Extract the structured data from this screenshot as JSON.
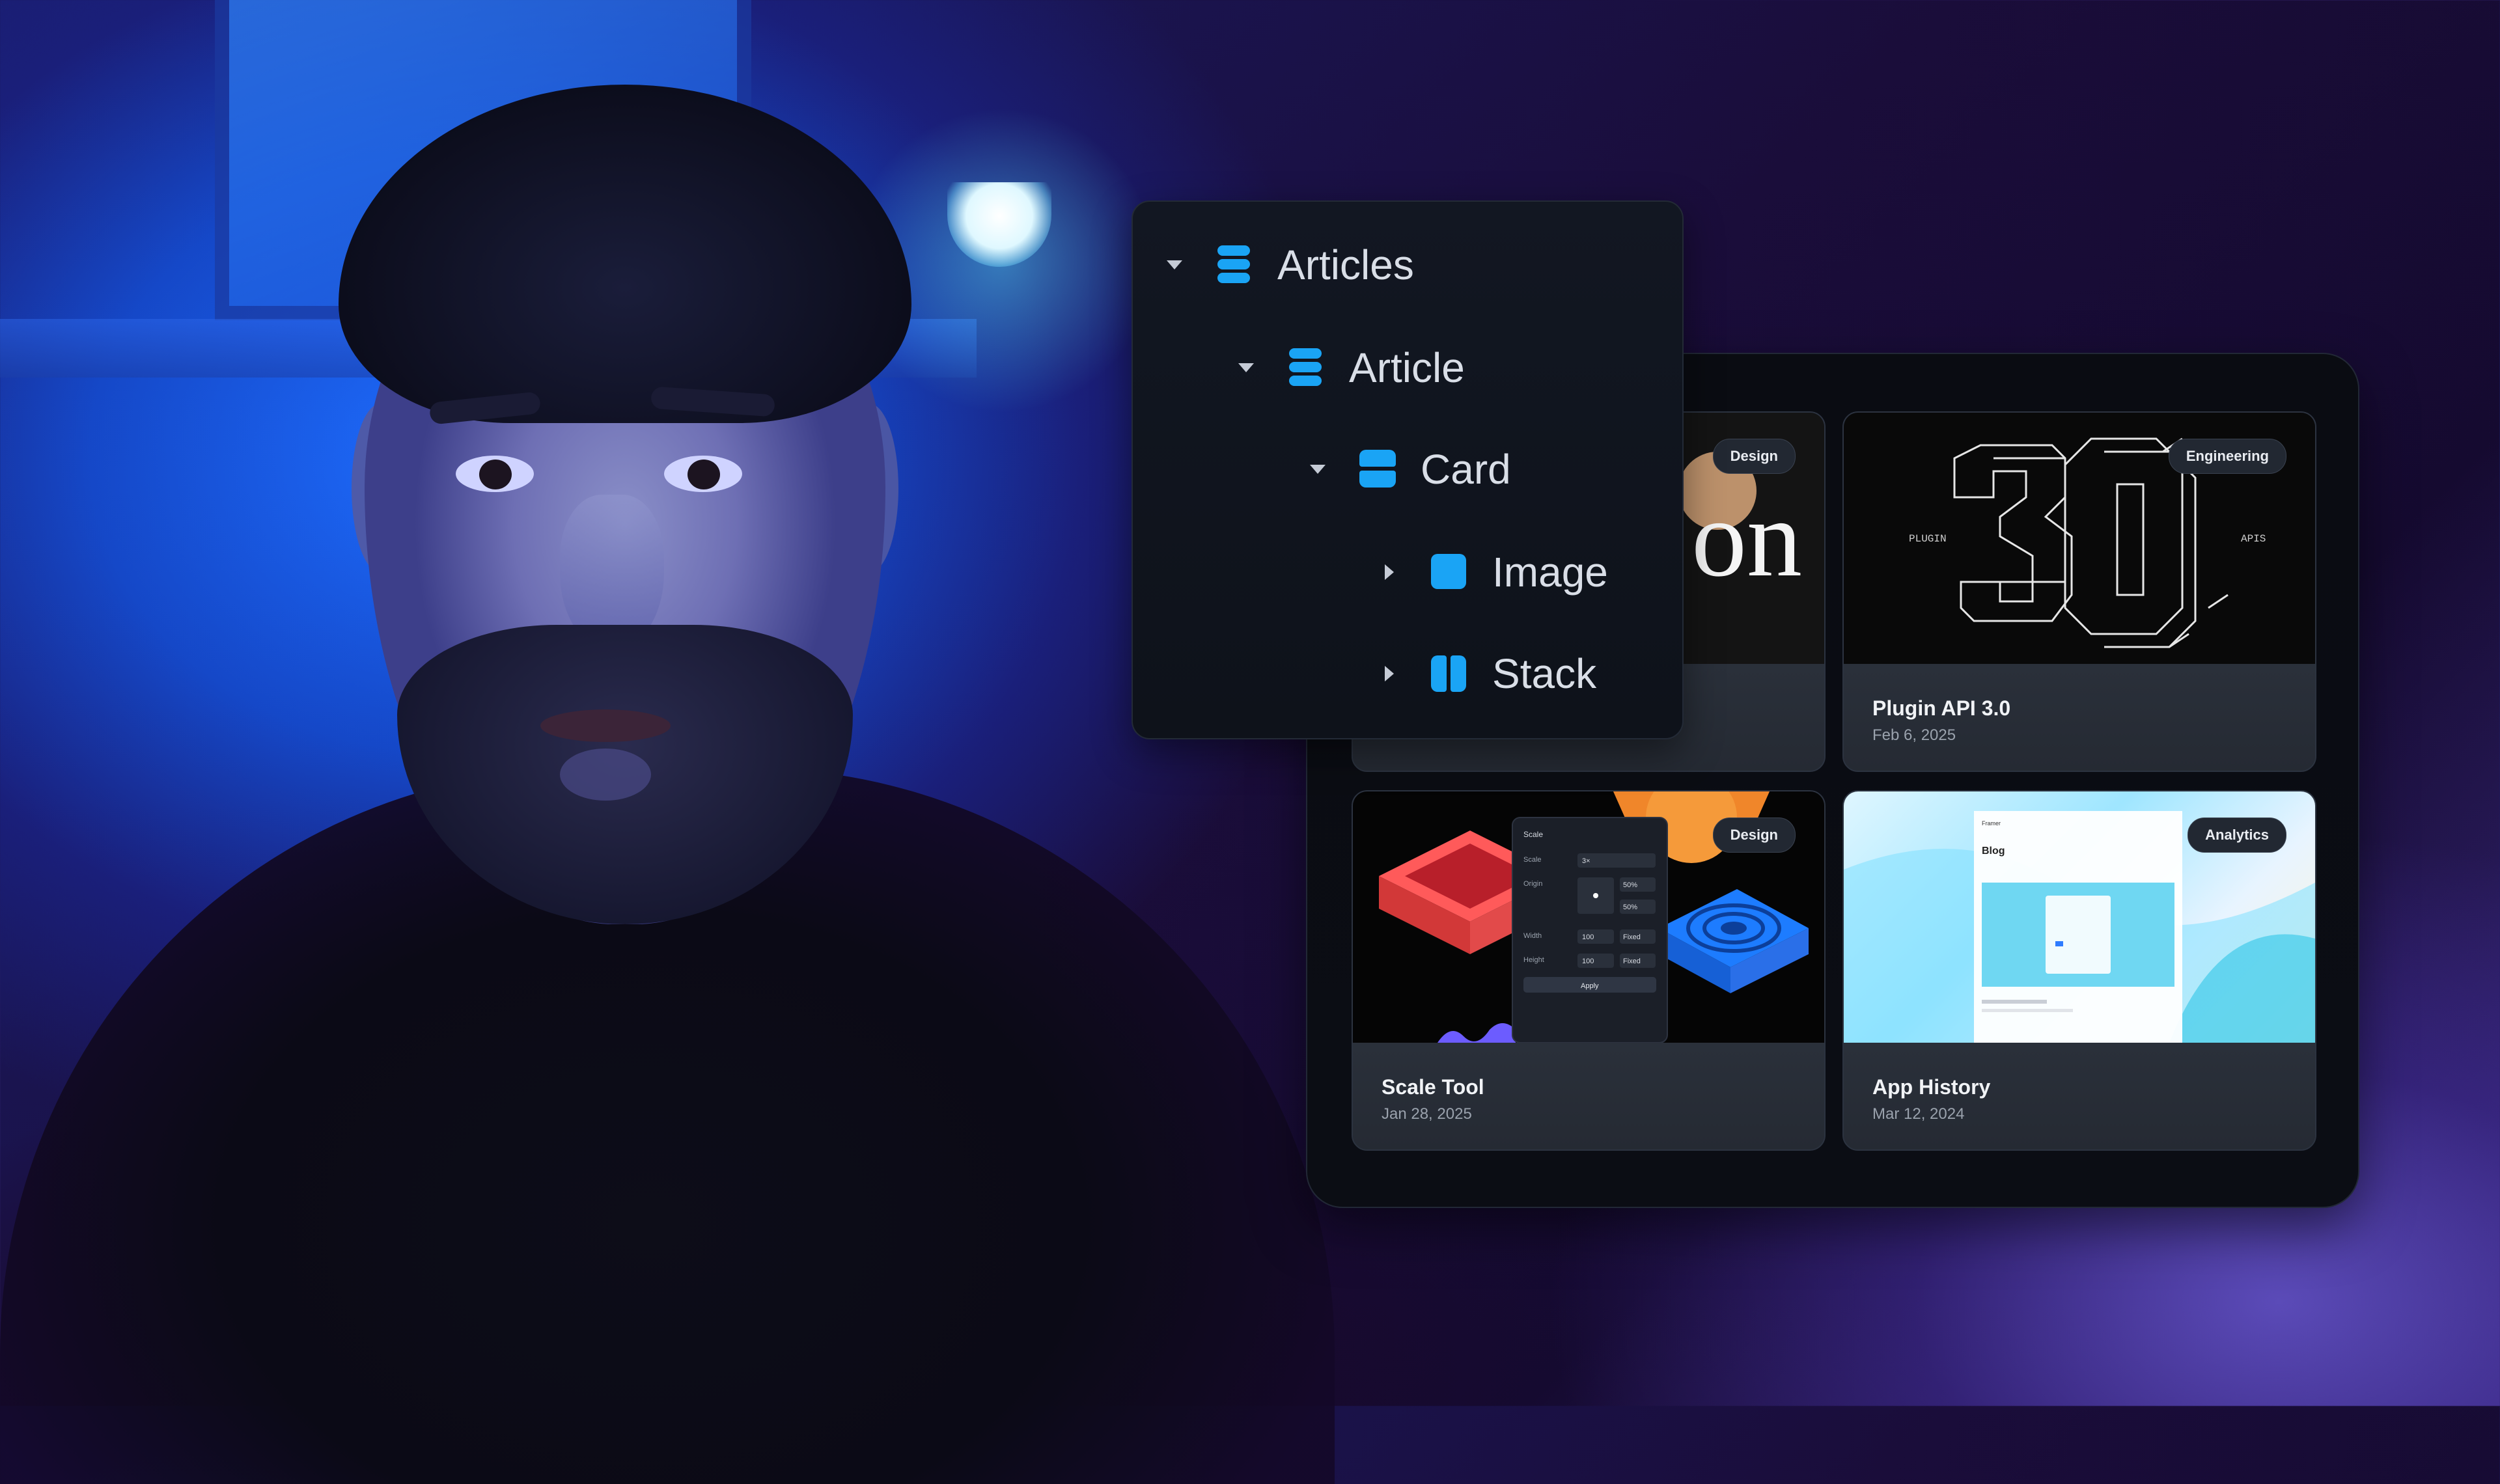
{
  "tree": {
    "items": [
      {
        "label": "Articles",
        "icon": "database-icon",
        "expanded": true
      },
      {
        "label": "Article",
        "icon": "database-icon",
        "expanded": true
      },
      {
        "label": "Card",
        "icon": "card-icon",
        "expanded": true
      },
      {
        "label": "Image",
        "icon": "image-icon",
        "expanded": false
      },
      {
        "label": "Stack",
        "icon": "stack-icon",
        "expanded": false
      }
    ]
  },
  "cards": [
    {
      "title": "",
      "date": "",
      "badge": "Design"
    },
    {
      "title": "Plugin API 3.0",
      "date": "Feb 6, 2025",
      "badge": "Engineering"
    },
    {
      "title": "Scale Tool",
      "date": "Jan 28, 2025",
      "badge": "Design"
    },
    {
      "title": "App History",
      "date": "Mar 12, 2024",
      "badge": "Analytics"
    }
  ],
  "thumbs": {
    "card1_glyph": "on",
    "card2_left": "PLUGIN",
    "card2_right": "APIS",
    "card3_panel": {
      "title": "Scale",
      "rows": [
        "Scale",
        "Origin",
        "Width",
        "Height"
      ],
      "values": [
        "3×",
        "50%",
        "50%",
        "100",
        "Fixed",
        "100",
        "Fixed"
      ],
      "apply": "Apply"
    },
    "card4_heading": "Blog",
    "card4_brand": "Framer"
  },
  "colors": {
    "accent": "#1aa4f5",
    "panel_bg": "#0e121a",
    "card_info_bg": "#2a303a"
  }
}
